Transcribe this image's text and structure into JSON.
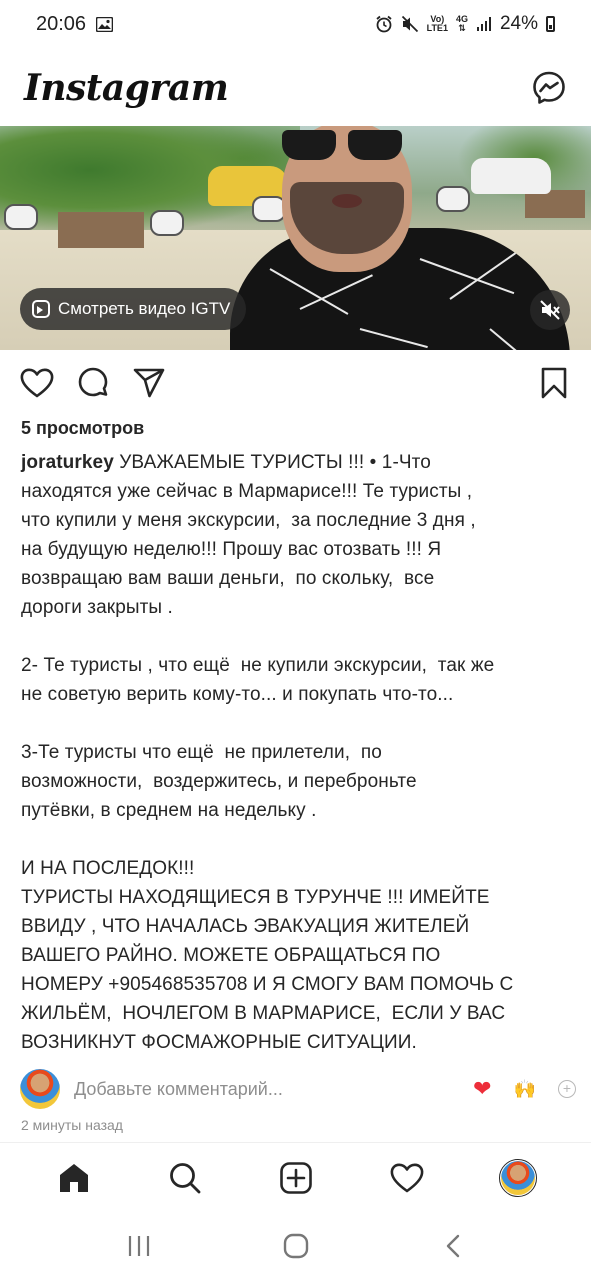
{
  "status_bar": {
    "time": "20:06",
    "network_top": "Vo)",
    "network_bottom": "LTE1",
    "gen_top": "4G",
    "battery": "24%"
  },
  "header": {
    "logo": "Instagram",
    "messenger_icon": "messenger-icon"
  },
  "video": {
    "igtv_label": "Смотреть видео IGTV",
    "igtv_icon": "igtv-icon",
    "mute_icon": "muted-speaker-icon"
  },
  "actions": {
    "like_icon": "heart-outline-icon",
    "comment_icon": "comment-icon",
    "share_icon": "paper-plane-icon",
    "save_icon": "bookmark-icon"
  },
  "post": {
    "views": "5 просмотров",
    "username": "joraturkey",
    "caption": " УВАЖАЕМЫЕ ТУРИСТЫ !!! • 1-Что\nнаходятся уже сейчас в Мармарисе!!! Те туристы ,\nчто купили у меня экскурсии,  за последние 3 дня ,\nна будущую неделю!!! Прошу вас отозвать !!! Я\nвозвращаю вам ваши деньги,  по скольку,  все\nдороги закрыты .\n\n2- Те туристы , что ещё  не купили экскурсии,  так же\nне советую верить кому-то... и покупать что-то...\n\n3-Те туристы что ещё  не прилетели,  по\nвозможности,  воздержитесь, и переброньте\nпутёвки, в среднем на недельку .\n\nИ НА ПОСЛЕДОК!!!\nТУРИСТЫ НАХОДЯЩИЕСЯ В ТУРУНЧЕ !!! ИМЕЙТЕ\nВВИДУ , ЧТО НАЧАЛАСЬ ЭВАКУАЦИЯ ЖИТЕЛЕЙ\nВАШЕГО РАЙНО. МОЖЕТЕ ОБРАЩАТЬСЯ ПО\nНОМЕРУ +905468535708 И Я СМОГУ ВАМ ПОМОЧЬ С\nЖИЛЬЁМ,  НОЧЛЕГОМ В МАРМАРИСЕ,  ЕСЛИ У ВАС\nВОЗНИКНУТ ФОСМАЖОРНЫЕ СИТУАЦИИ.",
    "comment_placeholder": "Добавьте комментарий...",
    "emoji_heart": "❤",
    "emoji_hands": "🙌",
    "emoji_more": "+",
    "timestamp": "2 минуты назад"
  },
  "tabbar": {
    "home_icon": "home-icon",
    "search_icon": "search-icon",
    "new_post_icon": "plus-square-icon",
    "activity_icon": "heart-outline-icon",
    "profile_icon": "profile-avatar"
  },
  "android_nav": {
    "recents_icon": "recents-icon",
    "home_icon": "home-circle-icon",
    "back_icon": "back-chevron-icon"
  },
  "colors": {
    "text": "#262626",
    "secondary": "#8e8e8e",
    "heart_red": "#ed2e3a"
  }
}
